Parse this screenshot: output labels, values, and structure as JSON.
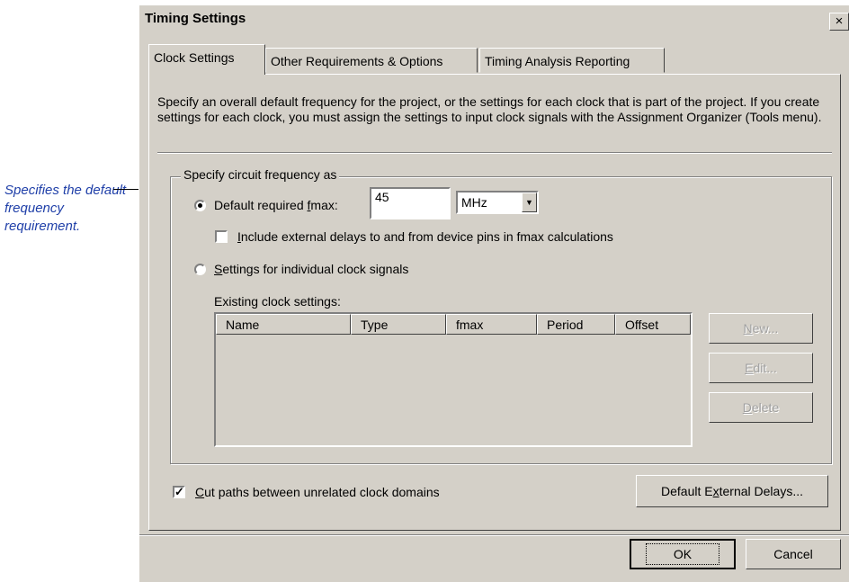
{
  "callout": {
    "text": "Specifies the default frequency requirement."
  },
  "dialog": {
    "title": "Timing Settings",
    "close_label": "×"
  },
  "tabs": [
    {
      "label": "Clock Settings"
    },
    {
      "label": "Other Requirements & Options"
    },
    {
      "label": "Timing Analysis Reporting"
    }
  ],
  "description": "Specify an overall default frequency for the project, or the settings for each clock that is part of the project.  If you create settings for each clock, you must assign the settings to input clock signals with the Assignment Organizer (Tools menu).",
  "group": {
    "label": "Specify circuit frequency as",
    "default_fmax": {
      "label_pre": "Default required ",
      "label_key": "f",
      "label_post": "max:",
      "selected": true,
      "value": "45",
      "unit": "MHz"
    },
    "include_external": {
      "label_key": "I",
      "label_rest": "nclude external delays to and from device pins in fmax calculations",
      "checked": false
    },
    "individual_clock": {
      "label_key": "S",
      "label_rest": "ettings for individual clock signals",
      "selected": false
    },
    "existing_label": "Existing clock settings:",
    "columns": [
      "Name",
      "Type",
      "fmax",
      "Period",
      "Offset"
    ],
    "buttons": {
      "new_key": "N",
      "new_rest": "ew...",
      "edit_key": "E",
      "edit_rest": "dit...",
      "delete_key": "D",
      "delete_rest": "elete"
    }
  },
  "cut_paths": {
    "label_key": "C",
    "label_rest": "ut paths between unrelated clock domains",
    "checked": true
  },
  "default_ext": {
    "pre": "Default E",
    "key": "x",
    "post": "ternal Delays..."
  },
  "ok_label": "OK",
  "cancel_label": "Cancel"
}
